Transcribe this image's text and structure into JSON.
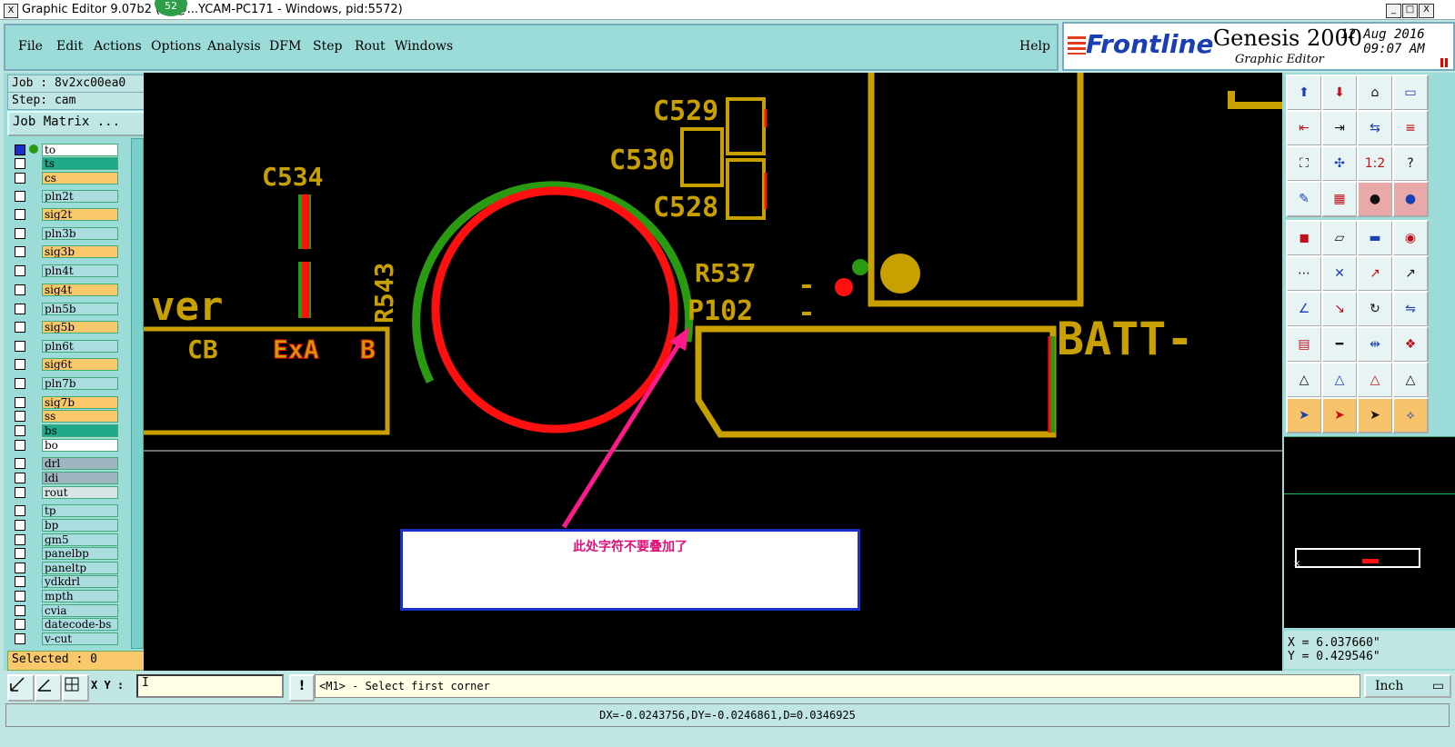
{
  "window": {
    "title": "Graphic Editor 9.07b2 (00@...YCAM-PC171 - Windows, pid:5572)",
    "badge": "52",
    "buttons": [
      "_",
      "□",
      "X"
    ]
  },
  "menu": {
    "items": [
      "File",
      "Edit",
      "Actions",
      "Options",
      "Analysis",
      "DFM",
      "Step",
      "Rout",
      "Windows"
    ],
    "help": "Help"
  },
  "brand": {
    "logo": "Frontline",
    "product": "Genesis 2000",
    "subtitle": "Graphic Editor",
    "date": "12 Aug 2016",
    "time": "09:07 AM"
  },
  "left_panel": {
    "job": "Job : 8v2xc00ea0",
    "step": "Step: cam",
    "job_matrix": "Job Matrix ...",
    "layers": [
      {
        "name": "to",
        "color": "#ffffff"
      },
      {
        "name": "ts",
        "color": "#1fa88a"
      },
      {
        "name": "cs",
        "color": "#f8c86a"
      },
      {
        "name": "pln2t",
        "color": "#a9dde0"
      },
      {
        "name": "sig2t",
        "color": "#f8c86a"
      },
      {
        "name": "pln3b",
        "color": "#a9dde0"
      },
      {
        "name": "sig3b",
        "color": "#f8c86a"
      },
      {
        "name": "pln4t",
        "color": "#a9dde0"
      },
      {
        "name": "sig4t",
        "color": "#f8c86a"
      },
      {
        "name": "pln5b",
        "color": "#a9dde0"
      },
      {
        "name": "sig5b",
        "color": "#f8c86a"
      },
      {
        "name": "pln6t",
        "color": "#a9dde0"
      },
      {
        "name": "sig6t",
        "color": "#f8c86a"
      },
      {
        "name": "pln7b",
        "color": "#a9dde0"
      },
      {
        "name": "sig7b",
        "color": "#f8c86a"
      },
      {
        "name": "ss",
        "color": "#f8c86a"
      },
      {
        "name": "bs",
        "color": "#1fa88a"
      },
      {
        "name": "bo",
        "color": "#ffffff"
      },
      {
        "name": "drl",
        "color": "#9fb5c0"
      },
      {
        "name": "ldi",
        "color": "#9fb5c0"
      },
      {
        "name": "rout",
        "color": "#d8e4e6"
      },
      {
        "name": "tp",
        "color": "#a9dde0"
      },
      {
        "name": "bp",
        "color": "#a9dde0"
      },
      {
        "name": "gm5",
        "color": "#a9dde0"
      },
      {
        "name": "panelbp",
        "color": "#a9dde0"
      },
      {
        "name": "paneltp",
        "color": "#a9dde0"
      },
      {
        "name": "ydkdrl",
        "color": "#a9dde0"
      },
      {
        "name": "mpth",
        "color": "#a9dde0"
      },
      {
        "name": "cvia",
        "color": "#a9dde0"
      },
      {
        "name": "datecode-bs",
        "color": "#a9dde0"
      },
      {
        "name": "v-cut",
        "color": "#a9dde0"
      }
    ],
    "selected": "Selected : 0"
  },
  "canvas": {
    "labels": {
      "c529": "C529",
      "c530": "C530",
      "c528": "C528",
      "c534": "C534",
      "r543": "R543",
      "r537": "R537",
      "p102": "P102",
      "ver": "ver",
      "cb": "CB",
      "exa": "ExA",
      "b": "B",
      "batt": "BATT-"
    },
    "annotation": "此处字符不要叠加了",
    "colors": {
      "trace": "#c8a000",
      "pad_red": "#ff1010",
      "pad_green": "#2a9a10",
      "arrow": "#ff1a8c"
    }
  },
  "coords": {
    "x": "X = 6.037660\"",
    "y": "Y = 0.429546\""
  },
  "bottom": {
    "xy_label": "X Y :",
    "xy_value": "I",
    "warn": "!",
    "prompt": "<M1> - Select first corner",
    "units": "Inch"
  },
  "status": "DX=-0.0243756,DY=-0.0246861,D=0.0346925"
}
